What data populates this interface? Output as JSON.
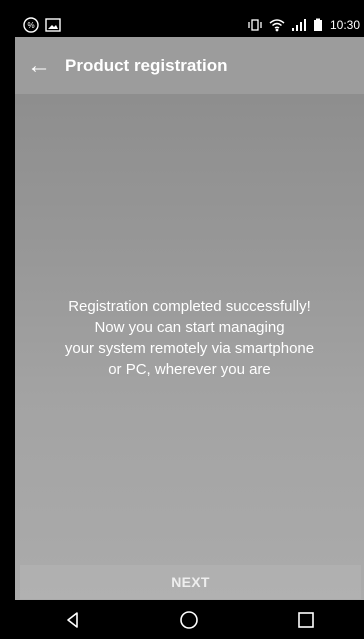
{
  "status_bar": {
    "time": "10:30",
    "icons": [
      "percent-badge-icon",
      "image-icon",
      "vibrate-icon",
      "wifi-icon",
      "signal-icon",
      "battery-icon"
    ]
  },
  "app_bar": {
    "title": "Product registration",
    "back_icon": "arrow-left-icon"
  },
  "content": {
    "message": "Registration completed successfully!\nNow you can start managing\nyour system remotely via smartphone\nor PC, wherever you are"
  },
  "footer": {
    "next_label": "NEXT"
  },
  "navigation": {
    "buttons": [
      "back-triangle-icon",
      "home-circle-icon",
      "recents-square-icon"
    ]
  },
  "colors": {
    "app_bar": "#9c9c9c",
    "content_top": "#8e8e8e",
    "content_bottom": "#ababab",
    "text": "#ffffff",
    "system_bar": "#000000"
  }
}
